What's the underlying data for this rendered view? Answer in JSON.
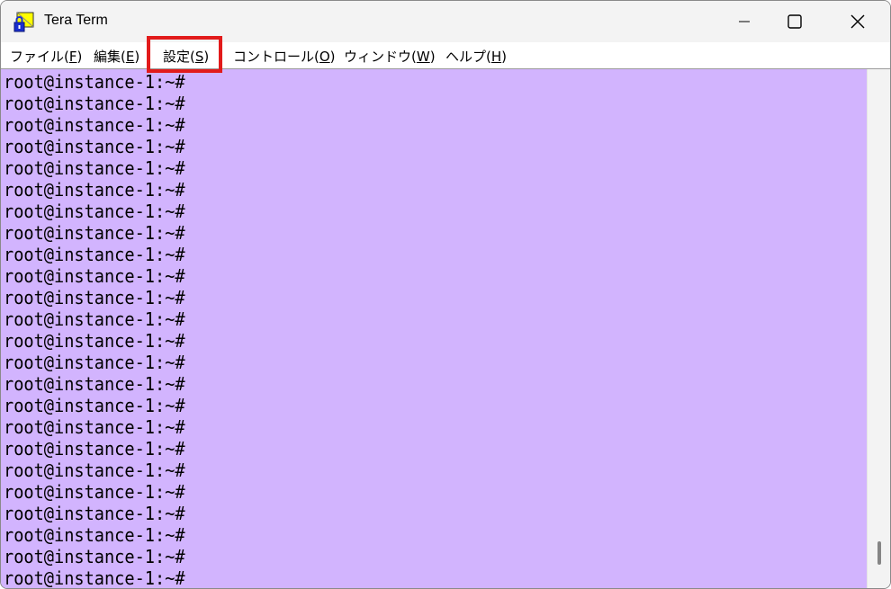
{
  "window": {
    "title": "Tera Term"
  },
  "menu": [
    {
      "label": "ファイル(",
      "accel": "F",
      "end": ")"
    },
    {
      "label": "編集(",
      "accel": "E",
      "end": ")"
    },
    {
      "label": "設定(",
      "accel": "S",
      "end": ")"
    },
    {
      "label": "コントロール(",
      "accel": "O",
      "end": ")"
    },
    {
      "label": "ウィンドウ(",
      "accel": "W",
      "end": ")"
    },
    {
      "label": "ヘルプ(",
      "accel": "H",
      "end": ")"
    }
  ],
  "terminal": {
    "background": "#d2b4fe",
    "lines": [
      "root@instance-1:~#",
      "root@instance-1:~#",
      "root@instance-1:~#",
      "root@instance-1:~#",
      "root@instance-1:~#",
      "root@instance-1:~#",
      "root@instance-1:~#",
      "root@instance-1:~#",
      "root@instance-1:~#",
      "root@instance-1:~#",
      "root@instance-1:~#",
      "root@instance-1:~#",
      "root@instance-1:~#",
      "root@instance-1:~#",
      "root@instance-1:~#",
      "root@instance-1:~#",
      "root@instance-1:~#",
      "root@instance-1:~#",
      "root@instance-1:~#",
      "root@instance-1:~#",
      "root@instance-1:~#",
      "root@instance-1:~#",
      "root@instance-1:~#",
      "root@instance-1:~#"
    ]
  },
  "highlight": {
    "target": "設定(S)",
    "color": "#e21b1b"
  }
}
